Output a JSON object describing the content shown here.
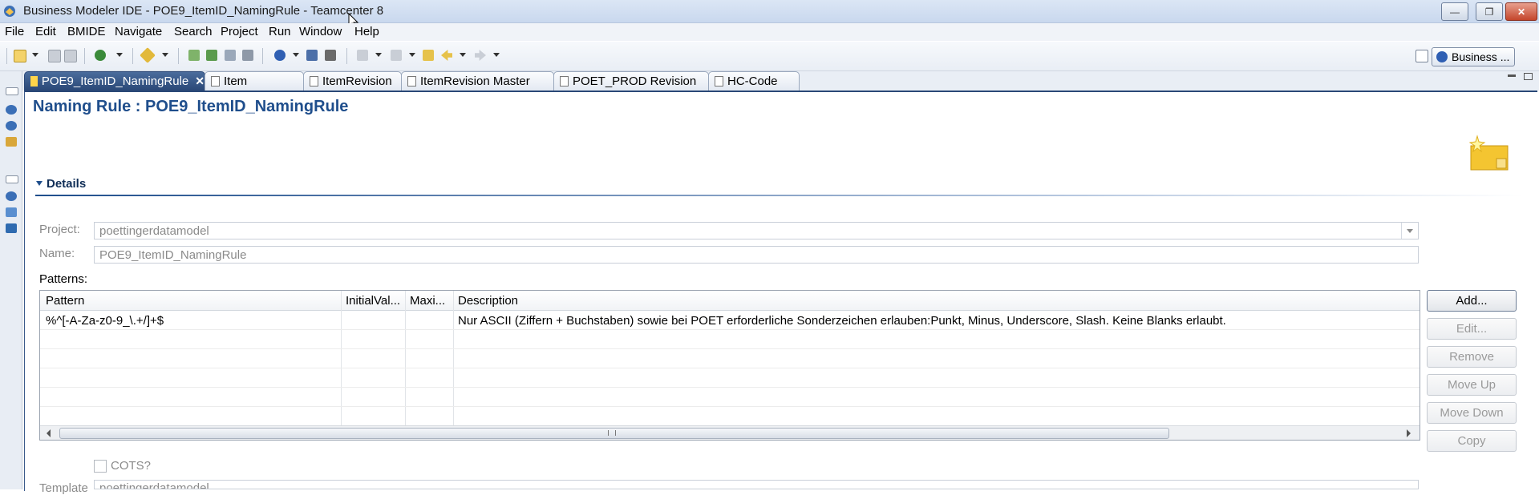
{
  "window": {
    "title": "Business Modeler IDE - POE9_ItemID_NamingRule - Teamcenter 8",
    "minimize_label": "—",
    "maximize_label": "❐",
    "close_label": "✕"
  },
  "menu": {
    "items": [
      "File",
      "Edit",
      "BMIDE",
      "Navigate",
      "Search",
      "Project",
      "Run",
      "Window",
      "Help"
    ]
  },
  "toolbar": {
    "perspective_label": "Business ..."
  },
  "tabs": [
    {
      "label": "POE9_ItemID_NamingRule",
      "active": true,
      "close": "✕"
    },
    {
      "label": "Item",
      "active": false
    },
    {
      "label": "ItemRevision",
      "active": false
    },
    {
      "label": "ItemRevision Master",
      "active": false
    },
    {
      "label": "POET_PROD Revision",
      "active": false
    },
    {
      "label": "HC-Code",
      "active": false
    }
  ],
  "editor": {
    "title": "Naming Rule : POE9_ItemID_NamingRule",
    "section_title": "Details",
    "project_label": "Project:",
    "project_value": "poettingerdatamodel",
    "name_label": "Name:",
    "name_value": "POE9_ItemID_NamingRule",
    "patterns_label": "Patterns:",
    "cots_label": "COTS?",
    "template_label": "Template",
    "template_value": "poettingerdatamodel"
  },
  "table": {
    "columns": [
      "Pattern",
      "InitialVal...",
      "Maxi...",
      "Description"
    ],
    "rows": [
      {
        "pattern": "%^[-A-Za-z0-9_\\.+/]+$",
        "initial": "",
        "max": "",
        "description": "Nur ASCII (Ziffern + Buchstaben) sowie bei POET erforderliche Sonderzeichen erlauben:Punkt, Minus, Underscore, Slash. Keine Blanks erlaubt."
      }
    ]
  },
  "buttons": {
    "add": "Add...",
    "edit": "Edit...",
    "remove": "Remove",
    "move_up": "Move Up",
    "move_down": "Move Down",
    "copy": "Copy"
  },
  "colors": {
    "accent": "#1f4e8c",
    "active_tab": "#2a4877"
  }
}
